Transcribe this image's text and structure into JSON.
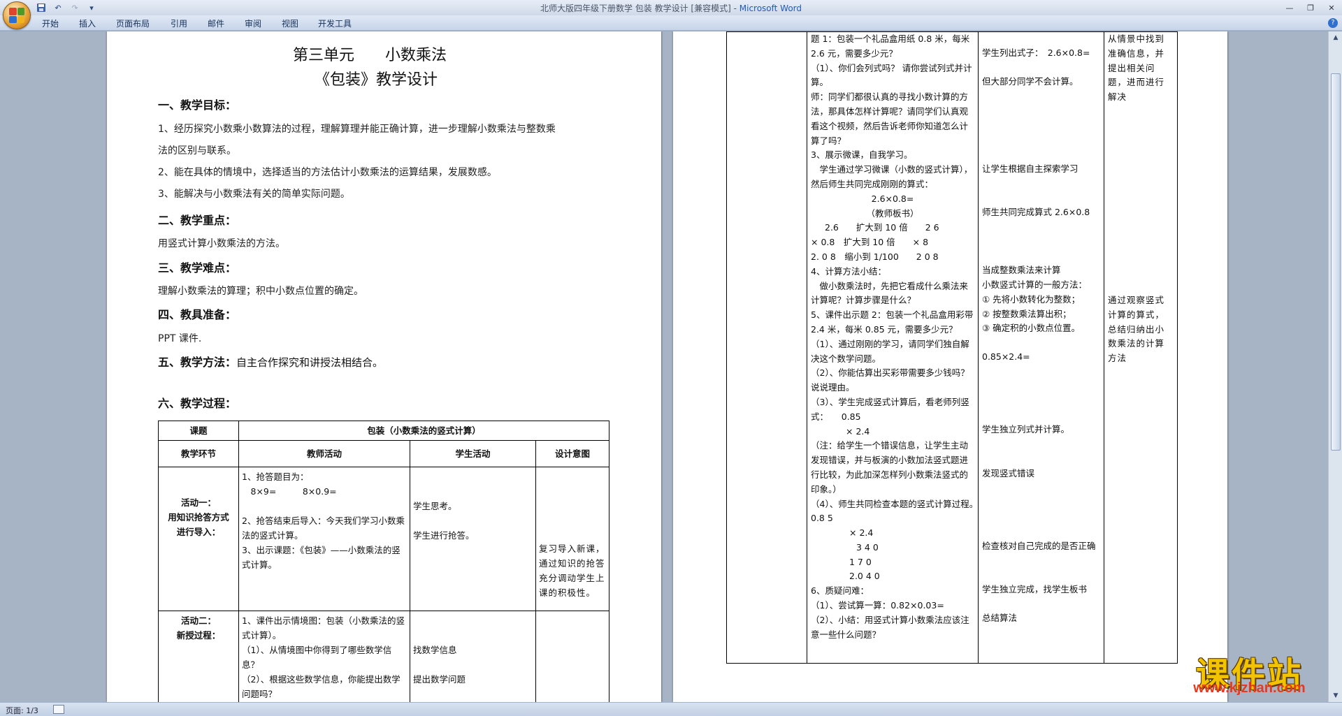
{
  "window": {
    "title": "北师大版四年级下册数学 包装 教学设计 [兼容模式]",
    "title_sep": " - ",
    "app_name": "Microsoft Word"
  },
  "ribbon": {
    "tabs": [
      "开始",
      "插入",
      "页面布局",
      "引用",
      "邮件",
      "审阅",
      "视图",
      "开发工具"
    ]
  },
  "status": {
    "page": "页面: 1/3"
  },
  "page1": {
    "heading1": "第三单元　　小数乘法",
    "heading2": "《包装》教学设计",
    "sec1": "一、教学目标：",
    "goal1a": "1、经历探究小数乘小数算法的过程，理解算理并能正确计算，进一步理解小数乘法与整数乘",
    "goal1b": "法的区别与联系。",
    "goal2": "2、能在具体的情境中，选择适当的方法估计小数乘法的运算结果，发展数感。",
    "goal3": "3、能解决与小数乘法有关的简单实际问题。",
    "sec2": "二、教学重点：",
    "key": "用竖式计算小数乘法的方法。",
    "sec3": "三、教学难点：",
    "difficulty": "理解小数乘法的算理；积中小数点位置的确定。",
    "sec4": "四、教具准备：",
    "prep": "PPT 课件.",
    "sec5_label": "五、教学方法：",
    "sec5_text": "自主合作探究和讲授法相结合。",
    "sec6": "六、教学过程：",
    "table": {
      "course_label": "课题",
      "course_title": "包装（小数乘法的竖式计算）",
      "headers": [
        "教学环节",
        "教师活动",
        "学生活动",
        "设计意图"
      ],
      "act1_name": [
        "活动一：",
        "用知识抢答方式",
        "进行导入："
      ],
      "act1_teacher": [
        "1、抢答题目为：",
        "　8×9=　　　8×0.9=",
        "2、抢答结束后导入：今天我们学习小数乘法的竖式计算。",
        "3、出示课题：《包装》——小数乘法的竖式计算。"
      ],
      "act1_student": [
        "学生思考。",
        "学生进行抢答。"
      ],
      "act1_intent": "复习导入新课，通过知识的抢答充分调动学生上课的积极性。",
      "act2_name": [
        "活动二：",
        "新授过程："
      ],
      "act2_teacher": [
        "1、课件出示情境图：包装（小数乘法的竖式计算）。",
        "（1）、从情境图中你得到了哪些数学信息？",
        "（2）、根据这些数学信息，你能提出数学问题吗？"
      ],
      "act2_student": [
        "找数学信息",
        "提出数学问题"
      ]
    }
  },
  "page2": {
    "teacher": [
      "题 1：包装一个礼品盒用纸 0.8 米，每米 2.6 元，需要多少元？",
      "（1）、你们会列式吗？ 请你尝试列式并计算。",
      "师：同学们都很认真的寻找小数计算的方法，那具体怎样计算呢？请同学们认真观看这个视频，然后告诉老师你知道怎么计算了吗？",
      "3、展示微课，自我学习。",
      "　学生通过学习微课（小数的竖式计算），然后师生共同完成刚刚的算式：",
      "2.6×0.8=",
      "（教师板书）",
      "2.6　　扩大到 10 倍　　2 6",
      "× 0.8　扩大到 10 倍　　× 8",
      "2. 0 8　缩小到 1/100　　2 0 8",
      "4、计算方法小结：",
      "　做小数乘法时，先把它看成什么乘法来计算呢？计算步骤是什么？",
      "5、课件出示题 2：包装一个礼品盒用彩带 2.4 米，每米 0.85 元，需要多少元？",
      "（1）、通过刚刚的学习，请同学们独自解决这个数学问题。",
      "（2）、你能估算出买彩带需要多少钱吗？说说理由。",
      "（3）、学生完成竖式计算后，看老师列竖式：　　0.85",
      "× 2.4",
      "（注：给学生一个错误信息，让学生主动发现错误，并与板演的小数加法竖式题进行比较，为此加深怎样列小数乘法竖式的印象。）",
      "（4）、师生共同检查本题的竖式计算过程。　　0.8 5",
      "× 2.4",
      "3 4 0",
      "1 7 0",
      "2.0 4 0",
      "6、质疑问难：",
      "（1）、尝试算一算：0.82×0.03=",
      "（2）、小结：用竖式计算小数乘法应该注意一些什么问题？"
    ],
    "student": {
      "s1": "学生列出式子：　2.6×0.8=",
      "s2": "但大部分同学不会计算。",
      "s3": "让学生根据自主探索学习",
      "s4": "师生共同完成算式 2.6×0.8",
      "s5": "当成整数乘法来计算",
      "s6": "小数竖式计算的一般方法：",
      "s7": "① 先将小数转化为整数；",
      "s8": "② 按整数乘法算出积；",
      "s9": "③ 确定积的小数点位置。",
      "s10": "0.85×2.4=",
      "s11": "学生独立列式并计算。",
      "s12": "发现竖式错误",
      "s13": "检查核对自己完成的是否正确",
      "s14": "学生独立完成，找学生板书",
      "s15": "总结算法"
    },
    "intent": {
      "i1": "从情景中找到准确信息，并提出相关问题，进而进行解决",
      "i2": "通过观察竖式计算的算式，总结归纳出小数乘法的计算方法"
    }
  },
  "watermark": {
    "title": "课件站",
    "url": "www.kjzhan.com"
  },
  "colors": {
    "app_accent": "#1e5bb8",
    "workspace": "#a7b4c6",
    "ribbon": "#dfe8f5",
    "watermark_gold": "#f2c400",
    "watermark_red": "#e63a1e"
  },
  "icons": {
    "office_button": "office-logo-icon",
    "save": "save-icon",
    "undo": "undo-icon",
    "redo": "redo-icon",
    "customize": "chevron-down-icon",
    "help": "help-icon"
  }
}
